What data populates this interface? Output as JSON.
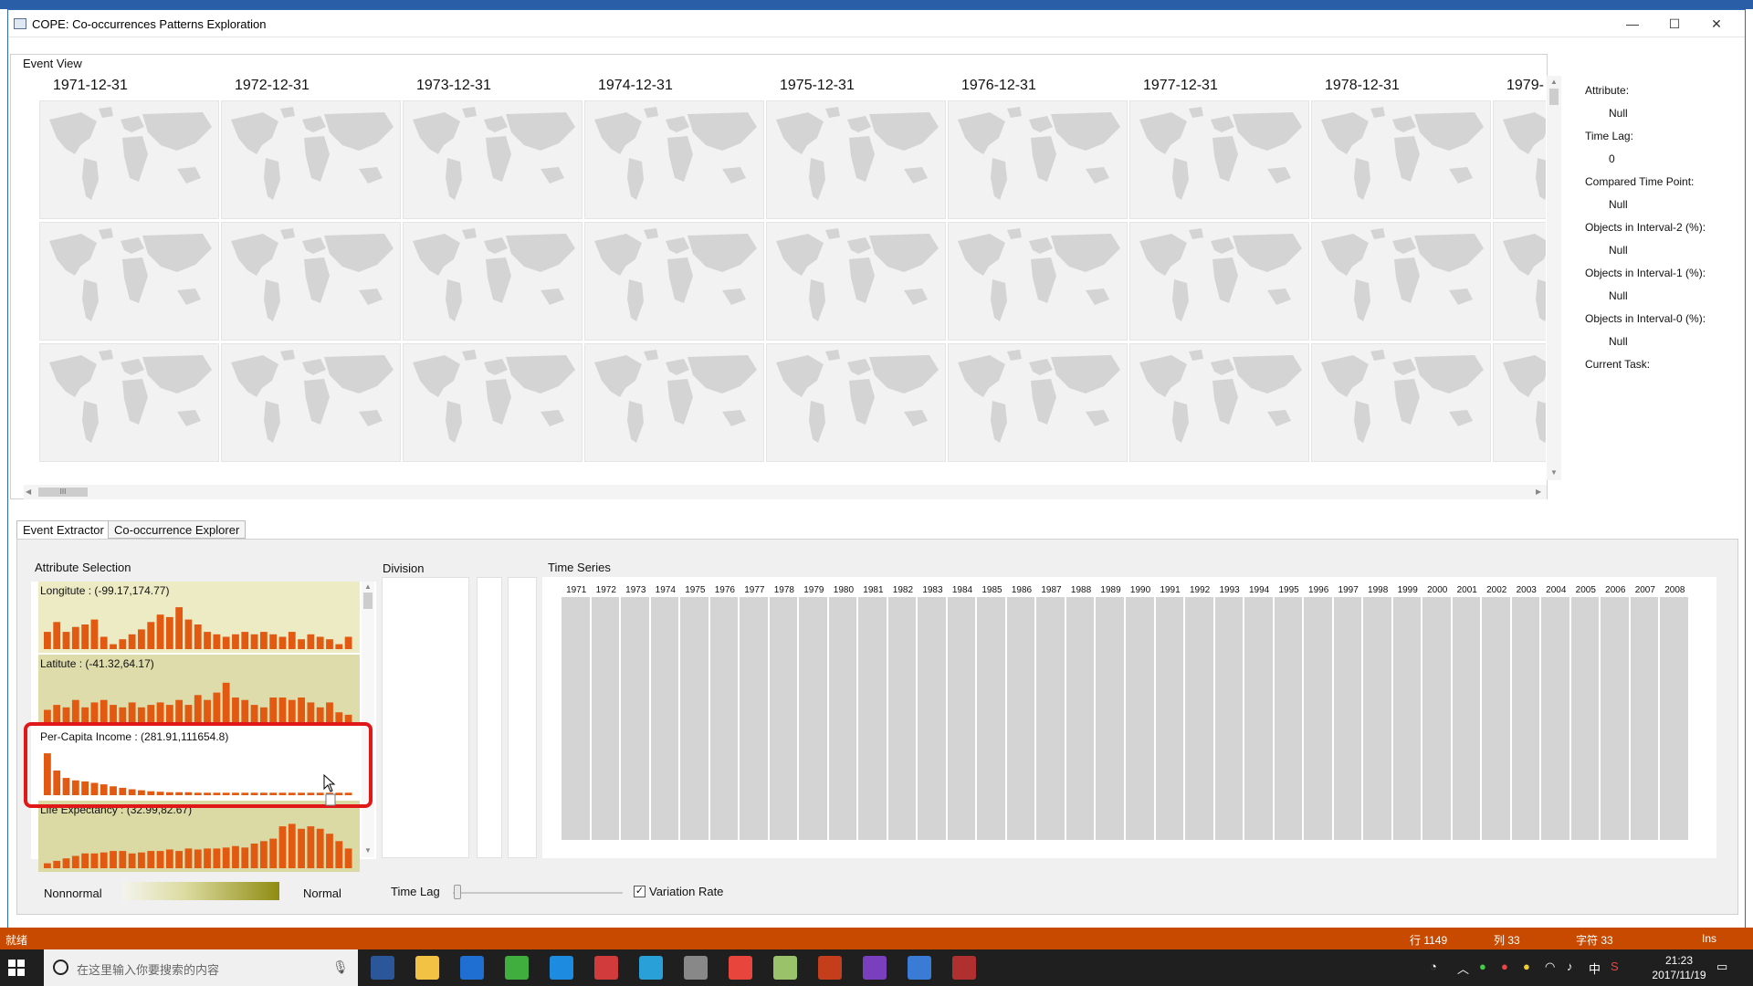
{
  "window": {
    "title": "COPE: Co-occurrences Patterns Exploration",
    "minimize": "—",
    "maximize": "☐",
    "close": "✕"
  },
  "event_view": {
    "legend": "Event View",
    "dates": [
      "1971-12-31",
      "1972-12-31",
      "1973-12-31",
      "1974-12-31",
      "1975-12-31",
      "1976-12-31",
      "1977-12-31",
      "1978-12-31",
      "1979-"
    ],
    "hscroll_thumb": "III"
  },
  "info_panel": {
    "items": [
      {
        "key": "Attribute:",
        "value": "Null"
      },
      {
        "key": "Time Lag:",
        "value": "0"
      },
      {
        "key": "Compared Time Point:",
        "value": "Null"
      },
      {
        "key": "Objects in Interval-2 (%):",
        "value": "Null"
      },
      {
        "key": "Objects in Interval-1 (%):",
        "value": "Null"
      },
      {
        "key": "Objects in Interval-0 (%):",
        "value": "Null"
      }
    ],
    "current_task": "Current Task:"
  },
  "tabs": [
    {
      "label": "Event Extractor",
      "active": true
    },
    {
      "label": "Co-occurrence Explorer",
      "active": false
    }
  ],
  "extractor": {
    "attribute_selection_label": "Attribute Selection",
    "division_label": "Division",
    "time_series_label": "Time Series",
    "attributes": [
      {
        "label": "Longitute : (-99.17,174.77)",
        "bg": "#ecebc4",
        "bars": [
          0.35,
          0.55,
          0.35,
          0.45,
          0.5,
          0.6,
          0.25,
          0.1,
          0.2,
          0.3,
          0.4,
          0.55,
          0.7,
          0.65,
          0.85,
          0.6,
          0.5,
          0.35,
          0.3,
          0.25,
          0.3,
          0.35,
          0.3,
          0.35,
          0.3,
          0.25,
          0.35,
          0.2,
          0.3,
          0.25,
          0.2,
          0.1,
          0.25
        ]
      },
      {
        "label": "Latitute : (-41.32,64.17)",
        "bg": "#dedcaa",
        "bars": [
          0.25,
          0.35,
          0.3,
          0.45,
          0.3,
          0.4,
          0.45,
          0.35,
          0.3,
          0.4,
          0.3,
          0.35,
          0.4,
          0.35,
          0.45,
          0.35,
          0.55,
          0.45,
          0.6,
          0.8,
          0.5,
          0.45,
          0.35,
          0.3,
          0.5,
          0.5,
          0.45,
          0.5,
          0.4,
          0.3,
          0.4,
          0.2,
          0.15
        ]
      },
      {
        "label": "Per-Capita Income : (281.91,111654.8)",
        "bg": "#ffffff",
        "bars": [
          0.85,
          0.5,
          0.35,
          0.3,
          0.28,
          0.25,
          0.22,
          0.18,
          0.15,
          0.12,
          0.1,
          0.08,
          0.07,
          0.06,
          0.06,
          0.06,
          0.05,
          0.05,
          0.05,
          0.05,
          0.05,
          0.05,
          0.05,
          0.05,
          0.05,
          0.05,
          0.05,
          0.05,
          0.05,
          0.05,
          0.05,
          0.05,
          0.05
        ]
      },
      {
        "label": "Life Expectancy : (32.99,82.67)",
        "bg": "#dbd9a4",
        "bars": [
          0.1,
          0.15,
          0.2,
          0.25,
          0.3,
          0.3,
          0.32,
          0.35,
          0.35,
          0.3,
          0.32,
          0.35,
          0.35,
          0.38,
          0.35,
          0.4,
          0.38,
          0.4,
          0.4,
          0.42,
          0.45,
          0.42,
          0.5,
          0.55,
          0.6,
          0.85,
          0.9,
          0.8,
          0.85,
          0.8,
          0.7,
          0.55,
          0.4
        ]
      }
    ],
    "years": [
      "1971",
      "1972",
      "1973",
      "1974",
      "1975",
      "1976",
      "1977",
      "1978",
      "1979",
      "1980",
      "1981",
      "1982",
      "1983",
      "1984",
      "1985",
      "1986",
      "1987",
      "1988",
      "1989",
      "1990",
      "1991",
      "1992",
      "1993",
      "1994",
      "1995",
      "1996",
      "1997",
      "1998",
      "1999",
      "2000",
      "2001",
      "2002",
      "2003",
      "2004",
      "2005",
      "2006",
      "2007",
      "2008"
    ],
    "legend_left": "Nonnormal",
    "legend_right": "Normal",
    "time_lag_label": "Time Lag",
    "time_lag_value": 0,
    "variation_rate_label": "Variation Rate",
    "variation_rate_checked": true,
    "checkbox_mark": "✓"
  },
  "status_bar": {
    "left": "就绪",
    "row": "行 1149",
    "col": "列 33",
    "chars": "字符 33",
    "mode": "Ins"
  },
  "taskbar": {
    "search_placeholder": "在这里输入你要搜索的内容",
    "time": "21:23",
    "date": "2017/11/19",
    "ime": "中",
    "icons": [
      "word-icon",
      "file-explorer-icon",
      "store-icon",
      "green-app-icon",
      "kite-icon",
      "red-app-icon",
      "blue-app-icon",
      "paint-icon",
      "chrome-icon",
      "notes-icon",
      "powerpoint-icon",
      "visual-studio-icon",
      "cope-app-icon",
      "pin-app-icon"
    ],
    "icon_colors": [
      "#2b579a",
      "#f2c245",
      "#1e6fd1",
      "#3fae3f",
      "#1d8ce0",
      "#d23b3b",
      "#2aa0d8",
      "#888888",
      "#e8453c",
      "#9ac26b",
      "#c43e1c",
      "#7a3fbf",
      "#3a7bd5",
      "#b03030"
    ]
  },
  "colors": {
    "bar_orange": "#e25a12",
    "status_orange": "#c84a00",
    "highlight_red": "#e01818",
    "map_land": "#d4d4d4"
  }
}
